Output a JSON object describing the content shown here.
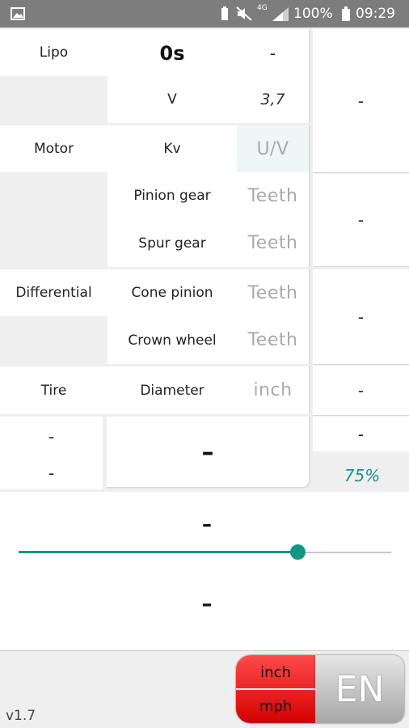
{
  "status_bar": {
    "network": "4G",
    "battery": "100%",
    "time": "09:29"
  },
  "lipo": {
    "label": "Lipo",
    "count": "0s",
    "count_result": "-",
    "volt_label": "V",
    "volt_value": "3,7",
    "result": "-"
  },
  "motor": {
    "label": "Motor",
    "kv_label": "Kv",
    "kv_placeholder": "U/V",
    "pinion_label": "Pinion gear",
    "pinion_placeholder": "Teeth",
    "spur_label": "Spur gear",
    "spur_placeholder": "Teeth",
    "result": "-"
  },
  "differential": {
    "label": "Differential",
    "cone_label": "Cone pinion",
    "cone_placeholder": "Teeth",
    "crown_label": "Crown wheel",
    "crown_placeholder": "Teeth",
    "result": "-"
  },
  "tire": {
    "label": "Tire",
    "diameter_label": "Diameter",
    "diameter_placeholder": "inch",
    "result": "-"
  },
  "totals": {
    "left_top": "-",
    "left_bottom": "-",
    "center": "–",
    "right_top": "-",
    "percent": "75%"
  },
  "slider": {
    "value_percent": 75,
    "top_value": "–",
    "bottom_value": "–"
  },
  "footer": {
    "version": "v1.7",
    "unit_length": "inch",
    "unit_speed": "mph",
    "language": "EN"
  },
  "colors": {
    "accent": "#139683",
    "unit_button": "#e81010",
    "statusbar": "#7d7d7d"
  }
}
